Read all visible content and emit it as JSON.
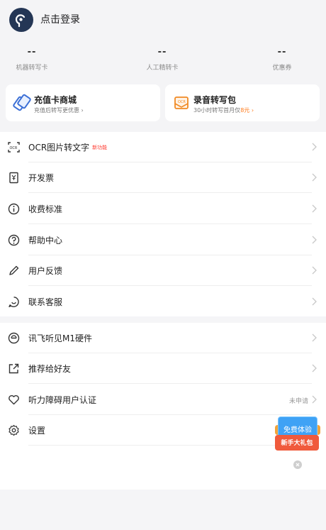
{
  "profile": {
    "login_label": "点击登录"
  },
  "stats": [
    {
      "value": "--",
      "label": "机器转写卡"
    },
    {
      "value": "--",
      "label": "人工精转卡"
    },
    {
      "value": "--",
      "label": "优惠券"
    }
  ],
  "cards": {
    "recharge": {
      "title": "充值卡商城",
      "subtitle": "充值后转写更优惠 ›"
    },
    "package": {
      "title": "录音转写包",
      "subtitle_prefix": "30小时转写首月仅",
      "subtitle_highlight": "8元 ›"
    }
  },
  "menu_group1": [
    {
      "label": "OCR图片转文字",
      "tag": "新功能"
    },
    {
      "label": "开发票"
    },
    {
      "label": "收费标准"
    },
    {
      "label": "帮助中心"
    },
    {
      "label": "用户反馈"
    },
    {
      "label": "联系客服"
    }
  ],
  "menu_group2": [
    {
      "label": "讯飞听见M1硬件"
    },
    {
      "label": "推荐给好友"
    },
    {
      "label": "听力障碍用户认证",
      "status": "未申请"
    },
    {
      "label": "设置"
    }
  ],
  "promo": {
    "top_label": "免费体验",
    "bottom_label": "新手大礼包"
  },
  "colors": {
    "avatar_bg": "#243655",
    "accent_orange": "#ff7a1a",
    "new_tag_red": "#ff3b30",
    "promo_blue": "#3fa2f5",
    "promo_red": "#f05a3c"
  },
  "icons": [
    "ear-logo-icon",
    "recharge-card-icon",
    "ocr-package-icon",
    "ocr-scan-icon",
    "invoice-icon",
    "info-icon",
    "help-icon",
    "pencil-icon",
    "chat-icon",
    "device-icon",
    "share-icon",
    "heart-icon",
    "settings-gear-icon",
    "chevron-right-icon",
    "close-icon"
  ]
}
